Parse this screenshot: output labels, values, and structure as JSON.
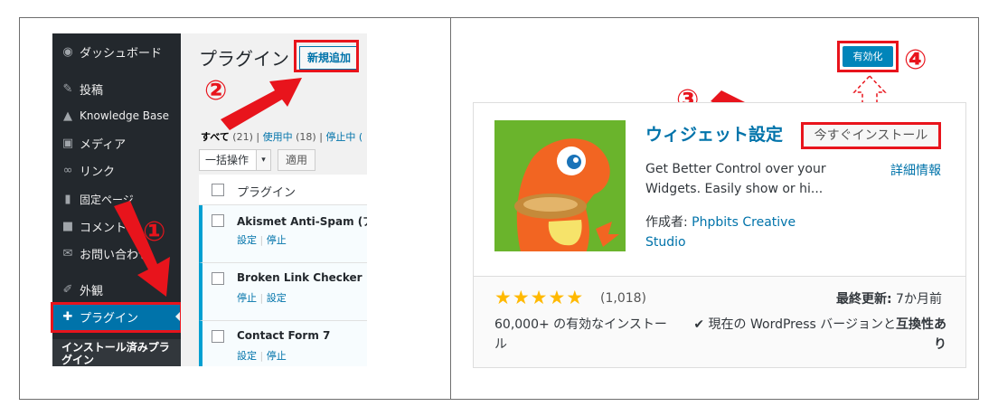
{
  "left_panel": {
    "sidebar": {
      "items": [
        {
          "label": "ダッシュボード",
          "icon": "dashboard-icon"
        },
        {
          "label": "投稿",
          "icon": "pin-icon"
        },
        {
          "label": "Knowledge Base",
          "icon": "graduation-cap-icon"
        },
        {
          "label": "メディア",
          "icon": "media-icon"
        },
        {
          "label": "リンク",
          "icon": "link-icon"
        },
        {
          "label": "固定ページ",
          "icon": "page-icon"
        },
        {
          "label": "コメント",
          "icon": "comment-icon"
        },
        {
          "label": "お問い合わせ",
          "icon": "mail-icon"
        },
        {
          "label": "外観",
          "icon": "brush-icon"
        },
        {
          "label": "プラグイン",
          "icon": "plugin-icon"
        }
      ],
      "submenu_title": "インストール済みプラグイン"
    },
    "main": {
      "title": "プラグイン",
      "add_new": "新規追加",
      "filters": {
        "all": "すべて",
        "all_count": "(21)",
        "active": "使用中",
        "active_count": "(18)",
        "inactive": "停止中 ("
      },
      "bulk_action": "一括操作",
      "apply": "適用",
      "column_header": "プラグイン",
      "plugins": [
        {
          "name": "Akismet Anti-Spam (アン",
          "action1": "設定",
          "action2": "停止"
        },
        {
          "name": "Broken Link Checker",
          "action1": "停止",
          "action2": "設定"
        },
        {
          "name": "Contact Form 7",
          "action1": "設定",
          "action2": "停止"
        }
      ]
    }
  },
  "right_panel": {
    "activate": "有効化",
    "plugin_title": "ウィジェット設定",
    "install_now": "今すぐインストール",
    "more_details": "詳細情報",
    "description": "Get Better Control over your Widgets. Easily show or hi...",
    "author_prefix": "作成者: ",
    "author_name": "Phpbits Creative Studio",
    "rating_count": "(1,018)",
    "rating": 5,
    "last_updated_label": "最終更新:",
    "last_updated_value": " 7か月前",
    "installs": "60,000+ の有効なインストール",
    "compat_prefix": "✔ 現在の WordPress バージョンと",
    "compat_bold": "互換性あり"
  },
  "annotations": {
    "step1": "①",
    "step2": "②",
    "step3": "③",
    "step4": "④"
  },
  "colors": {
    "highlight_red": "#e8141c",
    "wp_blue": "#0073aa",
    "sidebar_dark": "#23282d",
    "star_gold": "#ffb900"
  }
}
